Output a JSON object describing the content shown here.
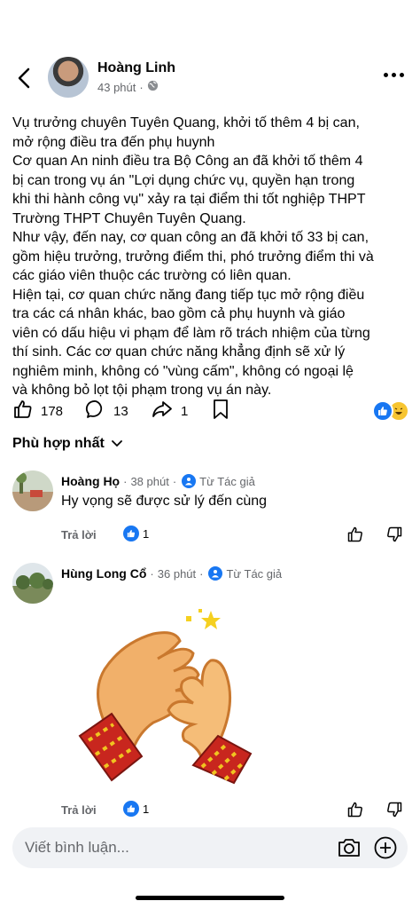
{
  "header": {
    "author": "Hoàng Linh",
    "time": "43 phút",
    "separator": "·"
  },
  "post": {
    "text": "Vụ trưởng chuyên Tuyên Quang, khởi tố thêm 4 bị can,\nmở rộng điều tra đến phụ huynh\nCơ quan An ninh điều tra Bộ Công an đã khởi tố thêm 4\nbị can trong vụ án \"Lợi dụng chức vụ, quyền hạn trong\nkhi thi hành công vụ\" xảy ra tại điểm thi tốt nghiệp THPT\nTrường THPT Chuyên Tuyên Quang.\nNhư vậy, đến nay, cơ quan công an đã khởi tố 33 bị can,\ngồm hiệu trưởng, trưởng điểm thi, phó trưởng điểm thi và\ncác giáo viên thuộc các trường có liên quan.\nHiện tại, cơ quan chức năng đang tiếp tục mở rộng điều\ntra các cá nhân khác, bao gồm cả phụ huynh và giáo\nviên có dấu hiệu vi phạm để làm rõ trách nhiệm của từng\nthí sinh. Các cơ quan chức năng khẳng định sẽ xử lý\nnghiêm minh, không có \"vùng cấm\", không có ngoại lệ\nvà không bỏ lọt tội phạm trong vụ án này."
  },
  "actions": {
    "likes": "178",
    "comments": "13",
    "shares": "1"
  },
  "sort_label": "Phù hợp nhất",
  "comments": [
    {
      "name": "Hoàng Họ",
      "time": "38 phút",
      "badge": "Từ Tác giả",
      "text": "Hy vọng sẽ được sử lý đến cùng",
      "reply": "Trả lời",
      "likes": "1"
    },
    {
      "name": "Hùng Long Cổ",
      "time": "36 phút",
      "badge": "Từ Tác giả",
      "reply": "Trả lời",
      "likes": "1"
    }
  ],
  "composer": {
    "placeholder": "Viết bình luận..."
  },
  "colors": {
    "brand_blue": "#1877f2",
    "secondary_text": "#65676b",
    "input_bg": "#f0f2f5"
  }
}
